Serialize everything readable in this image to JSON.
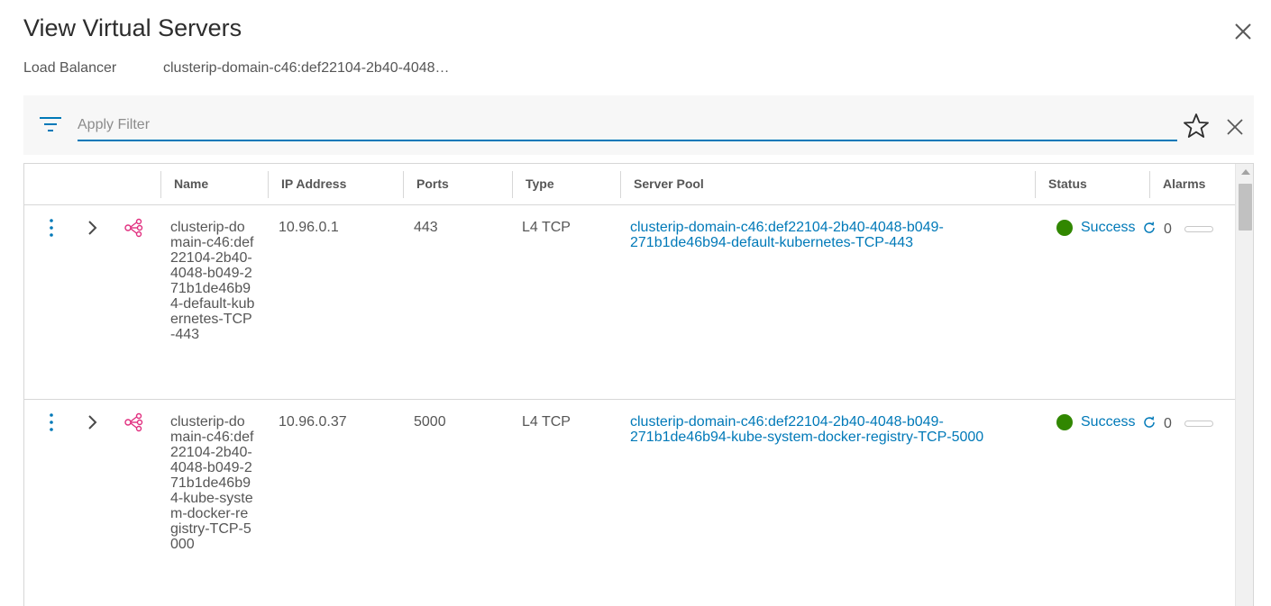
{
  "dialog": {
    "title": "View Virtual Servers",
    "load_balancer_label": "Load Balancer",
    "load_balancer_value": "clusterip-domain-c46:def22104-2b40-4048…"
  },
  "filter": {
    "placeholder": "Apply Filter",
    "value": ""
  },
  "table": {
    "columns": [
      "Name",
      "IP Address",
      "Ports",
      "Type",
      "Server Pool",
      "Status",
      "Alarms"
    ],
    "rows": [
      {
        "name": "clusterip-domain-c46:def22104-2b40-4048-b049-271b1de46b94-default-kubernetes-TCP-443",
        "ip": "10.96.0.1",
        "ports": "443",
        "type": "L4 TCP",
        "server_pool": "clusterip-domain-c46:def22104-2b40-4048-b049-271b1de46b94-default-kubernetes-TCP-443",
        "status": "Success",
        "alarms": "0"
      },
      {
        "name": "clusterip-domain-c46:def22104-2b40-4048-b049-271b1de46b94-kube-system-docker-registry-TCP-5000",
        "ip": "10.96.0.37",
        "ports": "5000",
        "type": "L4 TCP",
        "server_pool": "clusterip-domain-c46:def22104-2b40-4048-b049-271b1de46b94-kube-system-docker-registry-TCP-5000",
        "status": "Success",
        "alarms": "0"
      }
    ]
  },
  "colors": {
    "accent": "#0079b8",
    "success": "#318700",
    "lb_icon": "#e12f7f"
  },
  "icons": [
    "close-icon",
    "filter-icon",
    "star-icon",
    "clear-filter-icon",
    "kebab-menu-icon",
    "chevron-right-icon",
    "load-balancer-icon",
    "refresh-icon"
  ]
}
